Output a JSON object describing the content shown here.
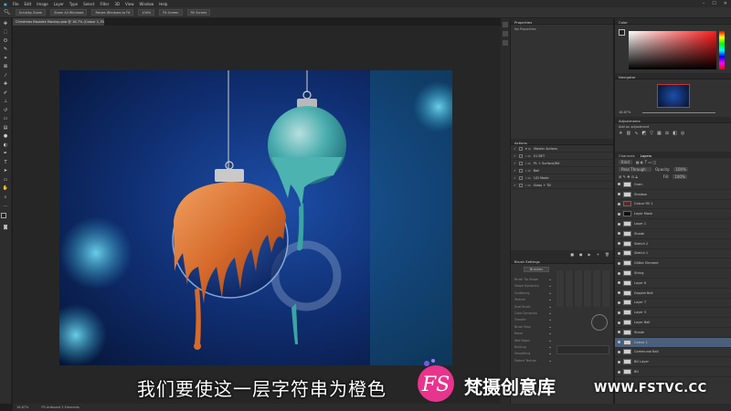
{
  "menu": [
    "File",
    "Edit",
    "Image",
    "Layer",
    "Type",
    "Select",
    "Filter",
    "3D",
    "View",
    "Window",
    "Help"
  ],
  "window_controls": [
    "–",
    "☐",
    "✕"
  ],
  "options_bar": [
    "Scrubby Zoom",
    "Zoom All Windows",
    "Resize Windows to Fit",
    "100%",
    "Fit Screen",
    "Fill Screen"
  ],
  "document_tab": "Christmas Baubles Mockup.psb @ 16.7% (Colour 1, RGB/8*) *",
  "status": {
    "zoom": "16.67%",
    "doc_info": "PS Artboard 3 Elements"
  },
  "panels": {
    "properties": {
      "title": "Properties",
      "subtitle": "No Properties"
    },
    "color": {
      "title": "Color"
    },
    "navigator": {
      "title": "Navigator",
      "zoom": "16.67%"
    },
    "adjustments": {
      "title": "Adjustments",
      "subtitle": "Add an adjustment"
    },
    "actions": {
      "title": "Actions",
      "items": [
        "Master Actions",
        "01 BET",
        "PL + Surface/Bit",
        "Ball",
        "1/D Mode",
        "Glass + Till"
      ]
    },
    "layers": {
      "tabs": [
        "Channels",
        "Layers"
      ],
      "blend_mode": "Pass Through",
      "opacity_label": "Opacity:",
      "opacity": "100%",
      "fill_label": "Fill:",
      "fill": "100%",
      "kind_filter": "Kind",
      "items": [
        {
          "name": "Grain"
        },
        {
          "name": "Shadow"
        },
        {
          "name": "Colour Fill 1"
        },
        {
          "name": "Layer Mask"
        },
        {
          "name": "Layer 1"
        },
        {
          "name": "Shade"
        },
        {
          "name": "Sketch 2"
        },
        {
          "name": "Sketch 1"
        },
        {
          "name": "Glitter Element"
        },
        {
          "name": "String"
        },
        {
          "name": "Layer 6"
        },
        {
          "name": "Droplet Ball"
        },
        {
          "name": "Layer 7"
        },
        {
          "name": "Layer 3"
        },
        {
          "name": "Layer Ball"
        },
        {
          "name": "Shade"
        },
        {
          "name": "Colour 1"
        },
        {
          "name": "Communal Ball"
        },
        {
          "name": "BG Layer"
        },
        {
          "name": "BG"
        }
      ]
    },
    "brush_settings": {
      "title": "Brush Settings",
      "brushes_button": "Brushes",
      "options": [
        "Brush Tip Shape",
        "Shape Dynamics",
        "Scattering",
        "Texture",
        "Dual Brush",
        "Color Dynamics",
        "Transfer",
        "Brush Pose",
        "Noise",
        "Wet Edges",
        "Build-up",
        "Smoothing",
        "Protect Texture"
      ]
    }
  },
  "subtitle": "我们要使这一层字符串为橙色",
  "watermark": {
    "logo": "FS",
    "name": "梵摄创意库",
    "url": "WWW.FSTVC.CC"
  },
  "colors": {
    "accent": "#4b5f7d",
    "orange": "#e07a3a",
    "teal": "#4cb3b0"
  }
}
